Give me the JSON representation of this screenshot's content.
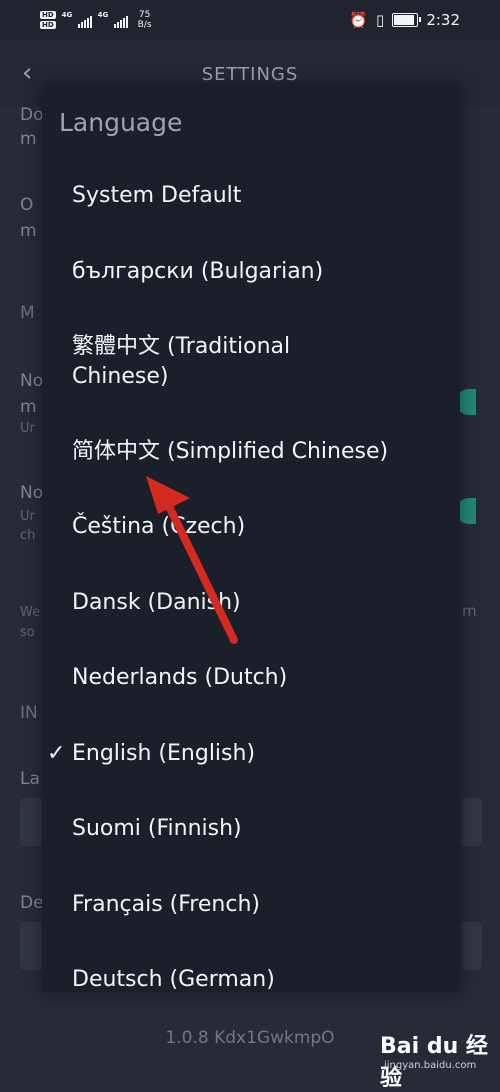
{
  "status_bar": {
    "hd1": "HD",
    "hd2": "HD",
    "signal1": "4G",
    "signal2": "4G",
    "speed_value": "75",
    "speed_unit": "B/s",
    "time": "2:32"
  },
  "header": {
    "title": "SETTINGS"
  },
  "background": {
    "fragments": [
      "Do",
      "m",
      "O",
      "m",
      "M",
      "No",
      "m",
      "Ur",
      "No",
      "Ur",
      "ch",
      "We",
      "so",
      "IN",
      "La",
      "De"
    ],
    "right_fragment": "m"
  },
  "dialog": {
    "title": "Language",
    "options": [
      {
        "label": "System Default",
        "checked": false
      },
      {
        "label": "български (Bulgarian)",
        "checked": false
      },
      {
        "label": "繁體中文 (Traditional Chinese)",
        "checked": false
      },
      {
        "label": "简体中文 (Simplified Chinese)",
        "checked": false
      },
      {
        "label": "Čeština (Czech)",
        "checked": false
      },
      {
        "label": "Dansk (Danish)",
        "checked": false
      },
      {
        "label": "Nederlands (Dutch)",
        "checked": false
      },
      {
        "label": "English (English)",
        "checked": true
      },
      {
        "label": "Suomi (Finnish)",
        "checked": false
      },
      {
        "label": "Français (French)",
        "checked": false
      },
      {
        "label": "Deutsch (German)",
        "checked": false
      }
    ],
    "check_glyph": "✓"
  },
  "footer": {
    "version": "1.0.8 Kdx1GwkmpO"
  },
  "watermark": {
    "logo_text": "Bai du 经验",
    "url": "jingyan.baidu.com"
  },
  "colors": {
    "annotation_arrow": "#d42a1f",
    "toggle_on": "#1fa98a"
  }
}
